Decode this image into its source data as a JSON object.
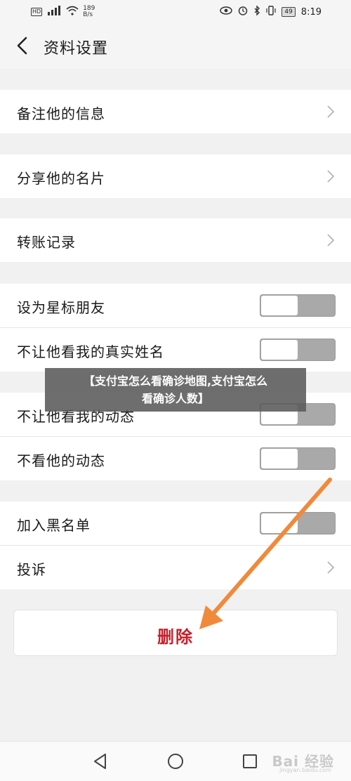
{
  "status_bar": {
    "hd": "HD",
    "signal": "⁴⁶",
    "speed_value": "189",
    "speed_unit": "B/s",
    "battery": "49",
    "time": "8:19"
  },
  "header": {
    "title": "资料设置"
  },
  "groups": [
    {
      "rows": [
        {
          "label": "备注他的信息",
          "control": "chevron"
        }
      ]
    },
    {
      "rows": [
        {
          "label": "分享他的名片",
          "control": "chevron"
        }
      ]
    },
    {
      "rows": [
        {
          "label": "转账记录",
          "control": "chevron"
        }
      ]
    },
    {
      "rows": [
        {
          "label": "设为星标朋友",
          "control": "toggle",
          "on": false
        },
        {
          "label": "不让他看我的真实姓名",
          "control": "toggle",
          "on": false
        }
      ]
    },
    {
      "rows": [
        {
          "label": "不让他看我的动态",
          "control": "toggle",
          "on": false
        },
        {
          "label": "不看他的动态",
          "control": "toggle",
          "on": false
        }
      ]
    },
    {
      "rows": [
        {
          "label": "加入黑名单",
          "control": "toggle",
          "on": false
        },
        {
          "label": "投诉",
          "control": "chevron"
        }
      ]
    }
  ],
  "delete_button": {
    "label": "删除"
  },
  "banner": {
    "line1": "【支付宝怎么看确诊地图,支付宝怎么",
    "line2": "看确诊人数】"
  },
  "watermark": {
    "main": "Bai  经验",
    "sub": "jingyan.baidu.com"
  },
  "colors": {
    "delete_text": "#c3212b",
    "toggle_off": "#a9a9a9",
    "arrow": "#f08a3a"
  },
  "icons": {
    "back": "chevron-left-icon",
    "row_chevron": "chevron-right-icon",
    "nav_back": "triangle-back-icon",
    "nav_home": "circle-home-icon",
    "nav_recent": "square-recent-icon"
  }
}
